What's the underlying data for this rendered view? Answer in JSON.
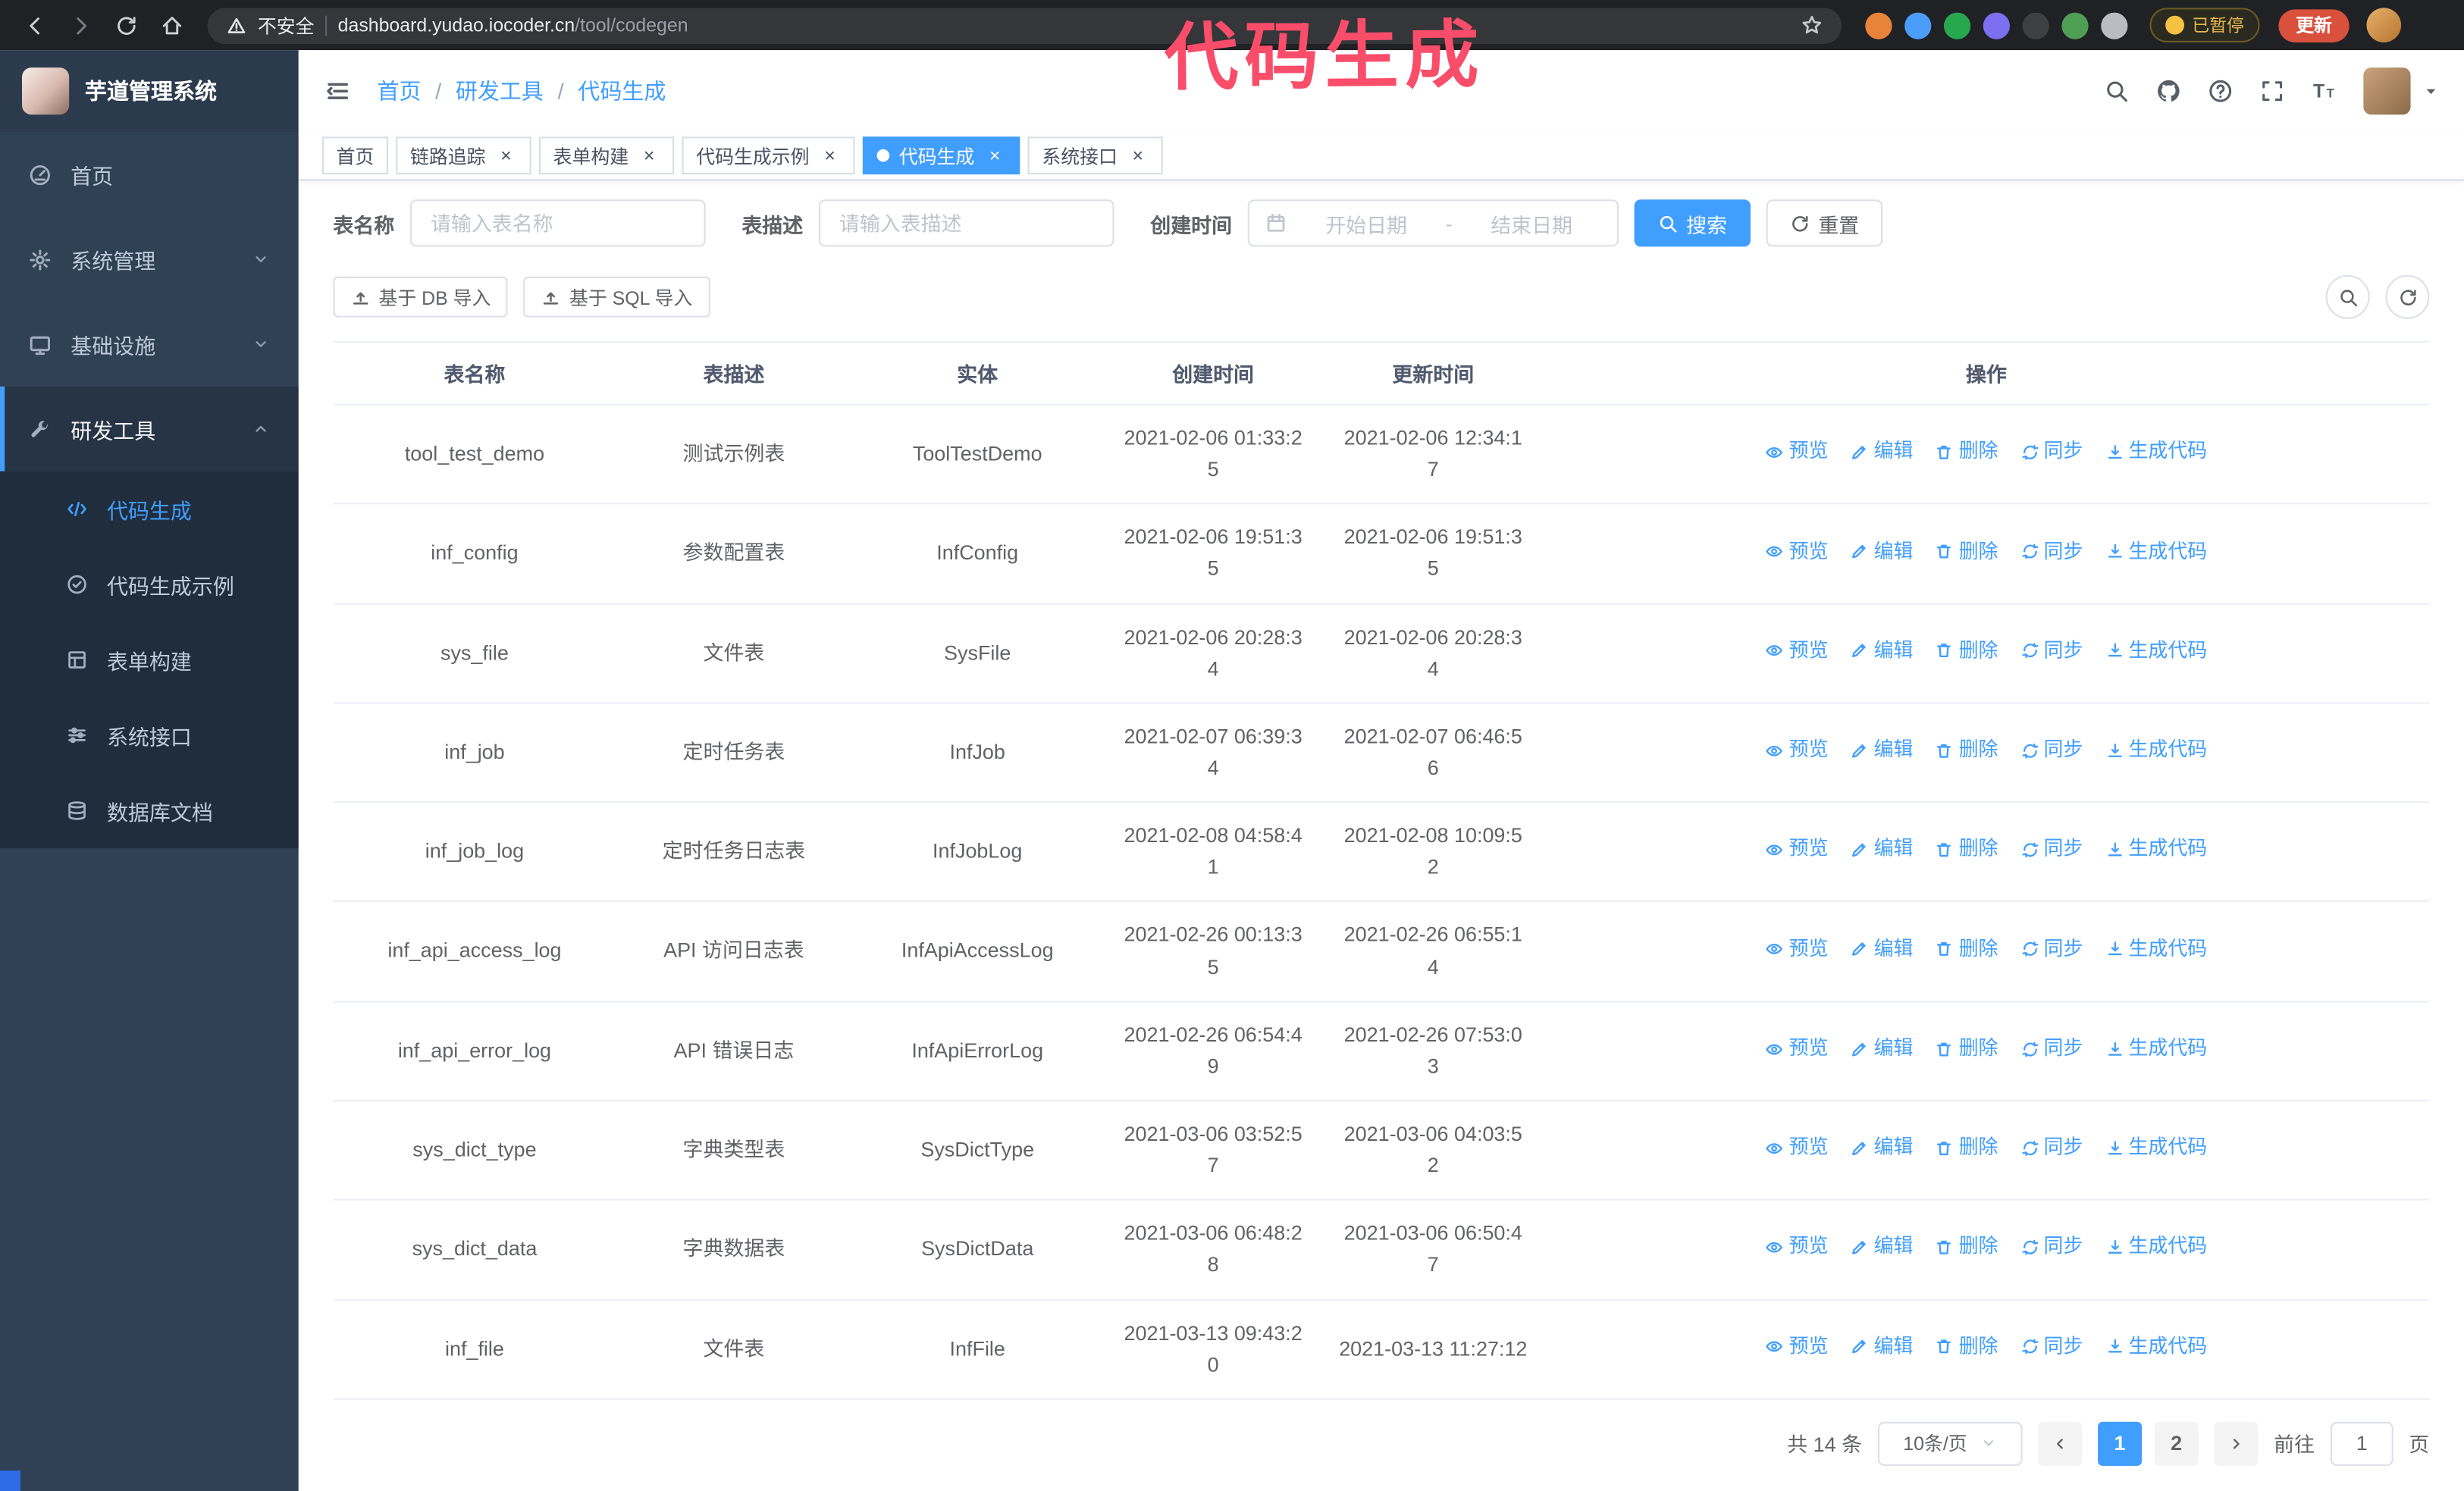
{
  "annotation": {
    "text": "代码生成",
    "color": "#f94d6a"
  },
  "browser": {
    "security_label": "不安全",
    "url_host": "dashboard.yudao.iocoder.cn",
    "url_path": "/tool/codegen",
    "paused_badge": "已暂停",
    "update_button": "更新",
    "extensions": [
      {
        "name": "extension-fox-icon",
        "color": "#e8833a"
      },
      {
        "name": "extension-blue-icon",
        "color": "#4a9df8"
      },
      {
        "name": "extension-green-check-icon",
        "color": "#27a84e"
      },
      {
        "name": "extension-people-icon",
        "color": "#7c6ff0"
      },
      {
        "name": "extension-dark-icon",
        "color": "#3d4043"
      },
      {
        "name": "extension-leaf-icon",
        "color": "#4e9e53"
      },
      {
        "name": "extension-puzzle-icon",
        "color": "#b9bdc1"
      }
    ]
  },
  "sidebar": {
    "logo_title": "芋道管理系统",
    "items": [
      {
        "name": "sidebar-item-dashboard",
        "label": "首页",
        "icon": "dashboard-icon",
        "chevron": null,
        "active": false
      },
      {
        "name": "sidebar-item-system",
        "label": "系统管理",
        "icon": "gear-icon",
        "chevron": "down",
        "active": false
      },
      {
        "name": "sidebar-item-infrastructure",
        "label": "基础设施",
        "icon": "monitor-icon",
        "chevron": "down",
        "active": false
      },
      {
        "name": "sidebar-item-devtools",
        "label": "研发工具",
        "icon": "tools-icon",
        "chevron": "up",
        "active": true
      }
    ],
    "sub_items": [
      {
        "name": "sidebar-subitem-codegen",
        "label": "代码生成",
        "icon": "code-icon",
        "active": true
      },
      {
        "name": "sidebar-subitem-codegen-example",
        "label": "代码生成示例",
        "icon": "example-icon",
        "active": false
      },
      {
        "name": "sidebar-subitem-form-builder",
        "label": "表单构建",
        "icon": "form-icon",
        "active": false
      },
      {
        "name": "sidebar-subitem-api",
        "label": "系统接口",
        "icon": "api-icon",
        "active": false
      },
      {
        "name": "sidebar-subitem-db-doc",
        "label": "数据库文档",
        "icon": "database-icon",
        "active": false
      }
    ]
  },
  "header": {
    "separator": "/",
    "breadcrumb": [
      {
        "label": "首页"
      },
      {
        "label": "研发工具"
      },
      {
        "label": "代码生成"
      }
    ]
  },
  "tabs": [
    {
      "name": "tab-home",
      "label": "首页",
      "closable": false,
      "active": false
    },
    {
      "name": "tab-tracing",
      "label": "链路追踪",
      "closable": true,
      "active": false
    },
    {
      "name": "tab-form-builder",
      "label": "表单构建",
      "closable": true,
      "active": false
    },
    {
      "name": "tab-codegen-example",
      "label": "代码生成示例",
      "closable": true,
      "active": false
    },
    {
      "name": "tab-codegen",
      "label": "代码生成",
      "closable": true,
      "active": true
    },
    {
      "name": "tab-api",
      "label": "系统接口",
      "closable": true,
      "active": false
    }
  ],
  "filters": {
    "table_name_label": "表名称",
    "table_name_placeholder": "请输入表名称",
    "table_desc_label": "表描述",
    "table_desc_placeholder": "请输入表描述",
    "create_time_label": "创建时间",
    "date_start_placeholder": "开始日期",
    "date_separator": "-",
    "date_end_placeholder": "结束日期",
    "search_button": "搜索",
    "reset_button": "重置"
  },
  "toolbar": {
    "import_db": "基于 DB 导入",
    "import_sql": "基于 SQL 导入"
  },
  "table": {
    "columns": [
      "表名称",
      "表描述",
      "实体",
      "创建时间",
      "更新时间",
      "操作"
    ],
    "actions": [
      "预览",
      "编辑",
      "删除",
      "同步",
      "生成代码"
    ],
    "rows": [
      {
        "name": "tool_test_demo",
        "desc": "测试示例表",
        "entity": "ToolTestDemo",
        "created": "2021-02-06 01:33:25",
        "updated": "2021-02-06 12:34:17"
      },
      {
        "name": "inf_config",
        "desc": "参数配置表",
        "entity": "InfConfig",
        "created": "2021-02-06 19:51:35",
        "updated": "2021-02-06 19:51:35"
      },
      {
        "name": "sys_file",
        "desc": "文件表",
        "entity": "SysFile",
        "created": "2021-02-06 20:28:34",
        "updated": "2021-02-06 20:28:34"
      },
      {
        "name": "inf_job",
        "desc": "定时任务表",
        "entity": "InfJob",
        "created": "2021-02-07 06:39:34",
        "updated": "2021-02-07 06:46:56"
      },
      {
        "name": "inf_job_log",
        "desc": "定时任务日志表",
        "entity": "InfJobLog",
        "created": "2021-02-08 04:58:41",
        "updated": "2021-02-08 10:09:52"
      },
      {
        "name": "inf_api_access_log",
        "desc": "API 访问日志表",
        "entity": "InfApiAccessLog",
        "created": "2021-02-26 00:13:35",
        "updated": "2021-02-26 06:55:14"
      },
      {
        "name": "inf_api_error_log",
        "desc": "API 错误日志",
        "entity": "InfApiErrorLog",
        "created": "2021-02-26 06:54:49",
        "updated": "2021-02-26 07:53:03"
      },
      {
        "name": "sys_dict_type",
        "desc": "字典类型表",
        "entity": "SysDictType",
        "created": "2021-03-06 03:52:57",
        "updated": "2021-03-06 04:03:52"
      },
      {
        "name": "sys_dict_data",
        "desc": "字典数据表",
        "entity": "SysDictData",
        "created": "2021-03-06 06:48:28",
        "updated": "2021-03-06 06:50:47"
      },
      {
        "name": "inf_file",
        "desc": "文件表",
        "entity": "InfFile",
        "created": "2021-03-13 09:43:20",
        "updated": "2021-03-13 11:27:12"
      }
    ]
  },
  "pagination": {
    "total_text": "共 14 条",
    "page_size_text": "10条/页",
    "pages": [
      "1",
      "2"
    ],
    "active_page": "1",
    "goto_prefix": "前往",
    "goto_value": "1",
    "goto_suffix": "页"
  }
}
